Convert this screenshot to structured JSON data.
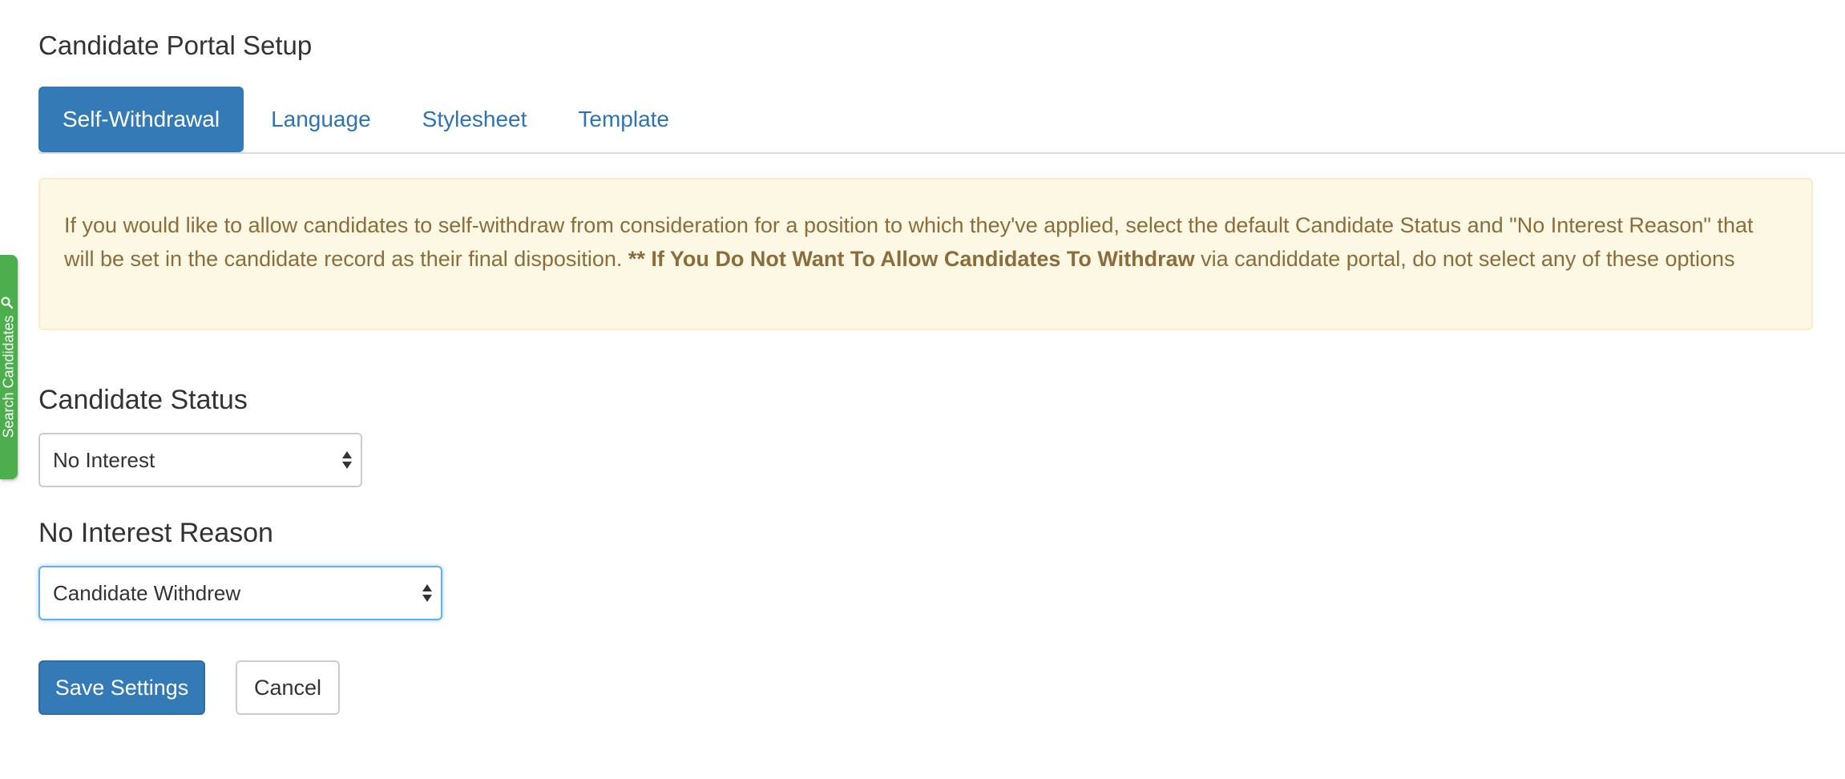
{
  "page": {
    "title": "Candidate Portal Setup"
  },
  "side_tab": {
    "label": "Search Candidates",
    "icon": "search-icon",
    "color": "#4cae4c"
  },
  "tabs": [
    {
      "label": "Self-Withdrawal",
      "active": true
    },
    {
      "label": "Language",
      "active": false
    },
    {
      "label": "Stylesheet",
      "active": false
    },
    {
      "label": "Template",
      "active": false
    }
  ],
  "alert": {
    "text_before": "If you would like to allow candidates to self-withdraw from consideration for a position to which they've applied, select the default Candidate Status and \"No Interest Reason\" that will be set in the candidate record as their final disposition. ",
    "bold_text": "** If You Do Not Want To Allow Candidates To Withdraw",
    "text_after": " via candiddate portal, do not select any of these options"
  },
  "form": {
    "candidate_status": {
      "label": "Candidate Status",
      "value": "No Interest"
    },
    "no_interest_reason": {
      "label": "No Interest Reason",
      "value": "Candidate Withdrew"
    }
  },
  "buttons": {
    "save_label": "Save Settings",
    "cancel_label": "Cancel"
  },
  "colors": {
    "primary": "#337ab7",
    "link": "#2f73b3",
    "alert_bg": "#fcf8e3",
    "alert_text": "#8a6d3b"
  }
}
